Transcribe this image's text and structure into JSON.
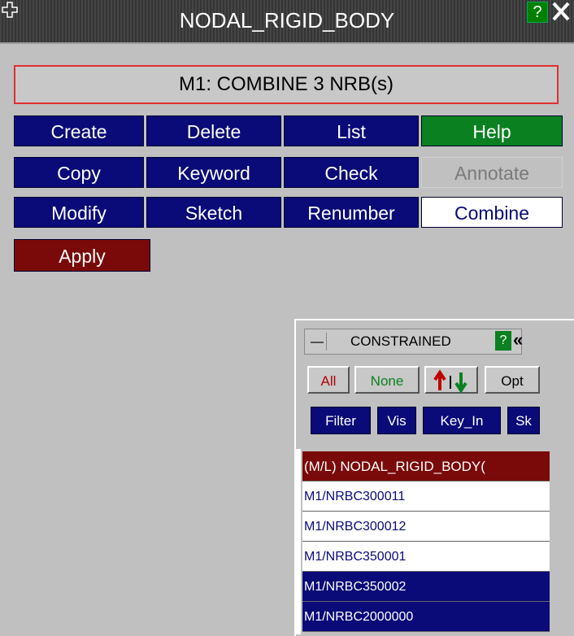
{
  "window": {
    "title": "NODAL_RIGID_BODY",
    "help_label": "?",
    "icons": {
      "move": "move-icon",
      "close": "close-icon"
    }
  },
  "model_status": "M1: COMBINE 3  NRB(s)",
  "buttons": {
    "create": "Create",
    "delete": "Delete",
    "list": "List",
    "help": "Help",
    "copy": "Copy",
    "keyword": "Keyword",
    "check": "Check",
    "annotate": "Annotate",
    "modify": "Modify",
    "sketch": "Sketch",
    "renumber": "Renumber",
    "combine": "Combine",
    "apply": "Apply"
  },
  "colors": {
    "button_blue": "#0a0a78",
    "help_green": "#0a8020",
    "apply_red": "#7a0a0a",
    "status_border": "#e03030"
  },
  "panel": {
    "title": "CONSTRAINED",
    "help_label": "?",
    "collapse_icon": "double-chevron-left-icon",
    "all": "All",
    "none": "None",
    "opt": "Opt",
    "filter": "Filter",
    "vis": "Vis",
    "key_in": "Key_In",
    "sk": "Sk",
    "list_header": "(M/L) NODAL_RIGID_BODY(",
    "items": [
      {
        "label": "M1/NRBC300011",
        "selected": false
      },
      {
        "label": "M1/NRBC300012",
        "selected": false
      },
      {
        "label": "M1/NRBC350001",
        "selected": false
      },
      {
        "label": "M1/NRBC350002",
        "selected": true
      },
      {
        "label": "M1/NRBC2000000",
        "selected": true
      }
    ]
  }
}
